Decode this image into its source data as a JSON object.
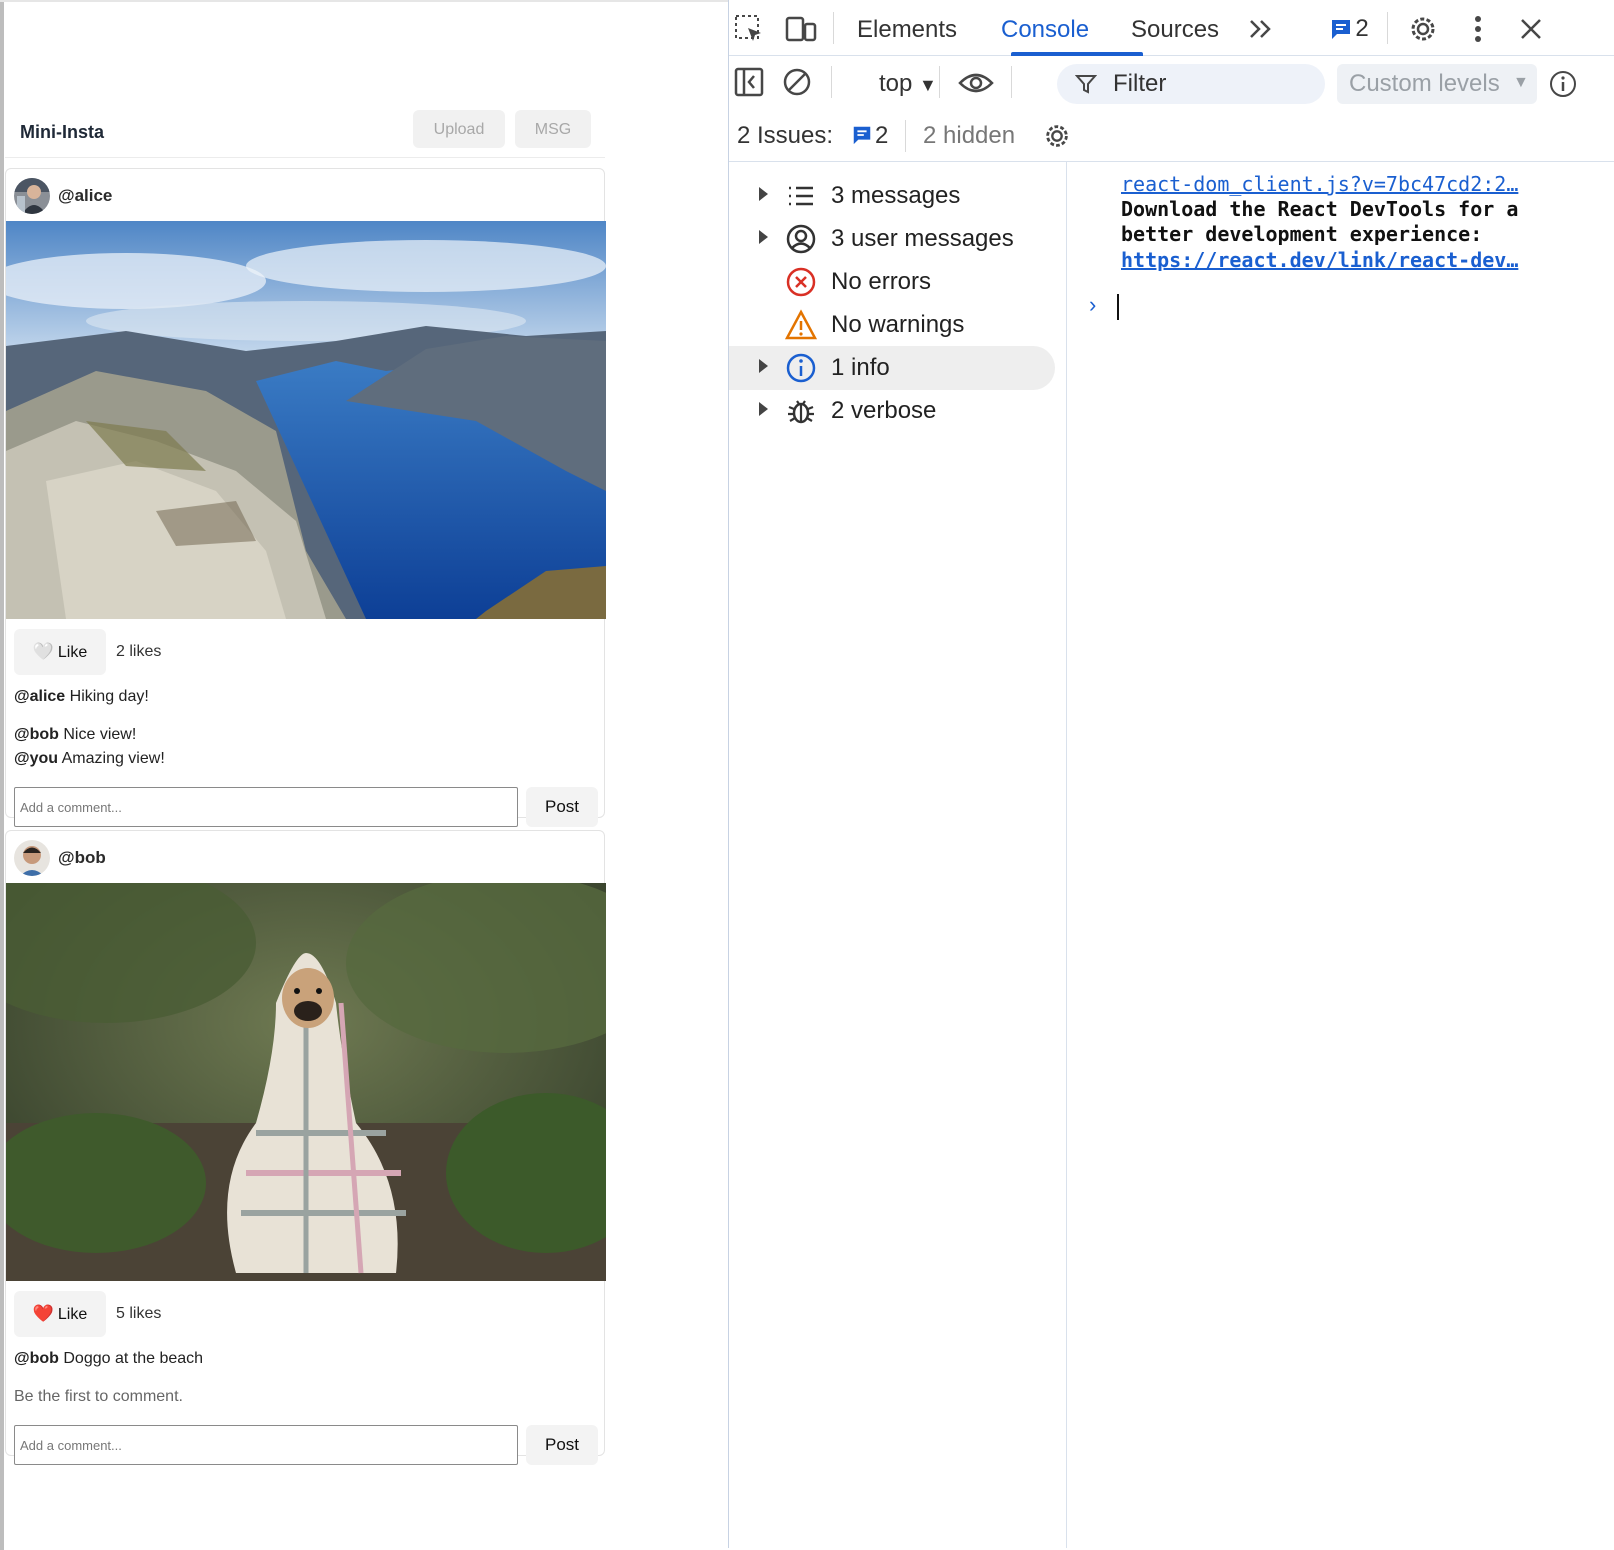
{
  "app": {
    "title": "Mini-Insta",
    "upload_label": "Upload",
    "msg_label": "MSG",
    "posts": [
      {
        "username": "@alice",
        "like_label": "Like",
        "liked": false,
        "likes": "2 likes",
        "caption_user": "@alice",
        "caption_text": " Hiking day!",
        "comments": [
          {
            "user": "@bob",
            "text": " Nice view!"
          },
          {
            "user": "@you",
            "text": " Amazing view!"
          }
        ],
        "comment_placeholder": "Add a comment...",
        "post_label": "Post"
      },
      {
        "username": "@bob",
        "like_label": "Like",
        "liked": true,
        "likes": "5 likes",
        "caption_user": "@bob",
        "caption_text": " Doggo at the beach",
        "empty_comments": "Be the first to comment.",
        "comment_placeholder": "Add a comment...",
        "post_label": "Post"
      }
    ]
  },
  "devtools": {
    "tabs": [
      "Elements",
      "Console",
      "Sources"
    ],
    "active_tab": "Console",
    "issues_badge": "2",
    "context": "top",
    "filter_placeholder": "Filter",
    "levels_label": "Custom levels",
    "issues_label": "2 Issues:",
    "issues_count": "2",
    "issues_hidden": "2 hidden",
    "sidebar": [
      {
        "label": "3 messages",
        "icon": "list-icon",
        "expandable": true
      },
      {
        "label": "3 user messages",
        "icon": "user-icon",
        "expandable": true
      },
      {
        "label": "No errors",
        "icon": "error-icon",
        "expandable": false
      },
      {
        "label": "No warnings",
        "icon": "warning-icon",
        "expandable": false
      },
      {
        "label": "1 info",
        "icon": "info-icon",
        "expandable": true,
        "selected": true
      },
      {
        "label": "2 verbose",
        "icon": "bug-icon",
        "expandable": true
      }
    ],
    "messages": {
      "source_link": "react-dom_client.js?v=7bc47cd2:2…",
      "line1": "Download the React DevTools for a",
      "line2": "better development experience:",
      "link": "https://react.dev/link/react-dev…"
    }
  },
  "colors": {
    "accent": "#1a5fd0",
    "error": "#d93025",
    "warning": "#e37400"
  }
}
